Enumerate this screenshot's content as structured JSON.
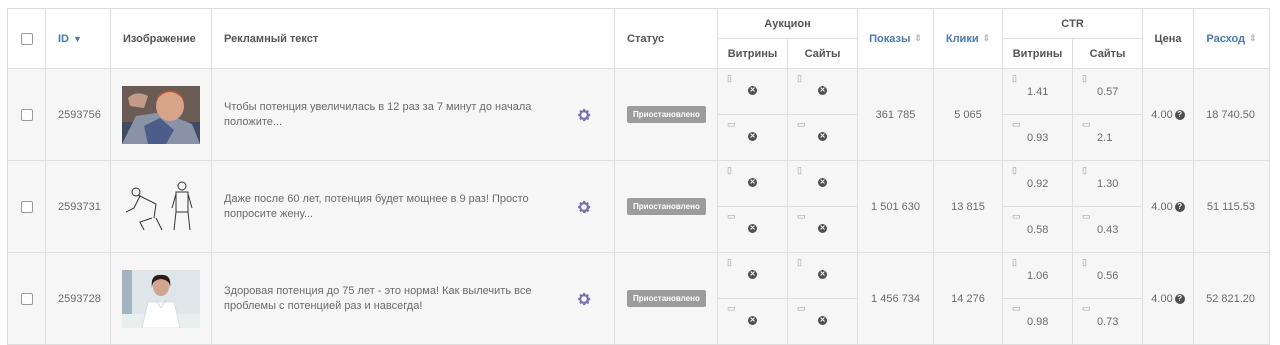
{
  "headers": {
    "id": "ID",
    "image": "Изображение",
    "ad_text": "Рекламный текст",
    "status": "Статус",
    "auction": "Аукцион",
    "auction_storefronts": "Витрины",
    "auction_sites": "Сайты",
    "impressions": "Показы",
    "clicks": "Клики",
    "ctr": "CTR",
    "ctr_storefronts": "Витрины",
    "ctr_sites": "Сайты",
    "price": "Цена",
    "spend": "Расход"
  },
  "icons": {
    "sort_desc": "triangle-down-icon",
    "sort": "sort-icon",
    "settings": "gear-icon",
    "mobile": "mobile-icon",
    "desktop": "desktop-icon",
    "disabled": "x-circle-icon",
    "help": "question-icon"
  },
  "colors": {
    "link": "#4a7ab1",
    "gear": "#7a6fb0",
    "status_bg": "#9c9c9c"
  },
  "rows": [
    {
      "id": "2593756",
      "ad_text": "Чтобы потенция увеличилась в 12 раз за 7 минут до начала положите...",
      "status": "Приостановлено",
      "impressions": "361 785",
      "clicks": "5 065",
      "ctr_storefronts_mobile": "1.41",
      "ctr_sites_mobile": "0.57",
      "ctr_storefronts_desktop": "0.93",
      "ctr_sites_desktop": "2.1",
      "price": "4.00",
      "spend": "18 740.50"
    },
    {
      "id": "2593731",
      "ad_text": "Даже после 60 лет, потенция будет мощнее в 9 раз! Просто попросите жену...",
      "status": "Приостановлено",
      "impressions": "1 501 630",
      "clicks": "13 815",
      "ctr_storefronts_mobile": "0.92",
      "ctr_sites_mobile": "1.30",
      "ctr_storefronts_desktop": "0.58",
      "ctr_sites_desktop": "0.43",
      "price": "4.00",
      "spend": "51 115.53"
    },
    {
      "id": "2593728",
      "ad_text": "Здоровая потенция до 75 лет - это норма! Как вылечить все проблемы с потенцией раз и навсегда!",
      "status": "Приостановлено",
      "impressions": "1 456 734",
      "clicks": "14 276",
      "ctr_storefronts_mobile": "1.06",
      "ctr_sites_mobile": "0.56",
      "ctr_storefronts_desktop": "0.98",
      "ctr_sites_desktop": "0.73",
      "price": "4.00",
      "spend": "52 821.20"
    }
  ]
}
